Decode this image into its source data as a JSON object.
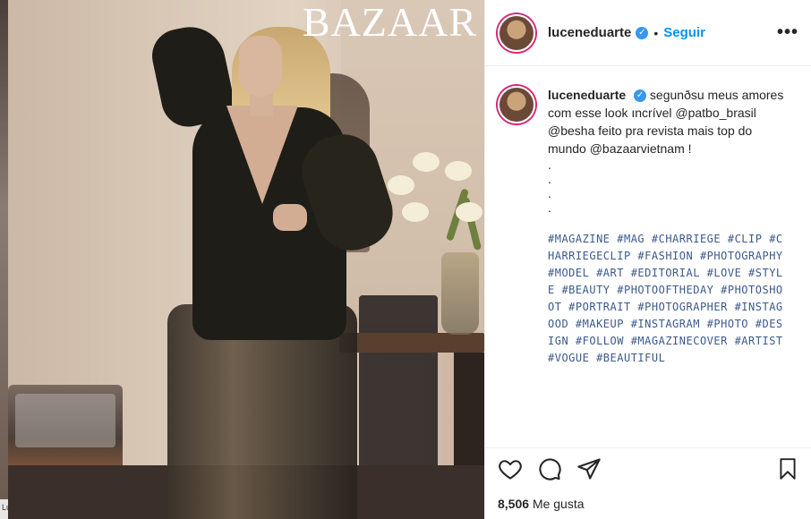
{
  "left_strip": {
    "tag": "LuEs/"
  },
  "photo": {
    "brand": "BAZAAR"
  },
  "post": {
    "username": "luceneduarte",
    "follow_label": "Seguir",
    "more_label": "•••",
    "caption": {
      "username": "luceneduarte",
      "text": "segunðsu meus amores com esse look ıncrível @patbo_brasil @besha feito pra revista mais top do mundo @bazaarvietnam !",
      "dots": [
        ".",
        ".",
        ".",
        "."
      ],
      "hashtags": "#MAGAZINE #MAG #CHARRIEGE #CLIP #CHARRIEGECLIP #FASHION #PHOTOGRAPHY #MODEL #ART #EDITORIAL #LOVE #STYLE #BEAUTY #PHOTOOFTHEDAY #PHOTOSHOOT #PORTRAIT #PHOTOGRAPHER #INSTAGOOD #MAKEUP #INSTAGRAM #PHOTO #DESIGN #FOLLOW #MAGAZINECOVER #ARTIST #VOGUE #BEAUTIFUL"
    },
    "likes": {
      "count": "8,506",
      "label": "Me gusta"
    }
  },
  "icons": {
    "like": "heart-icon",
    "comment": "comment-icon",
    "share": "paper-plane-icon",
    "save": "bookmark-icon",
    "verified": "verified-badge-icon"
  },
  "colors": {
    "follow": "#0095f6",
    "verified": "#3897f0",
    "hashtag": "#3b5a8c",
    "story_ring": "#d6297b"
  }
}
